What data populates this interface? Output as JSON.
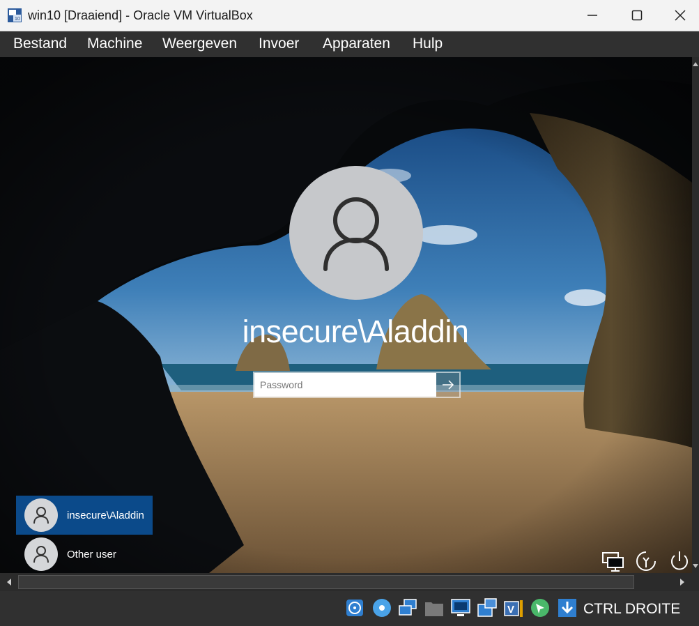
{
  "window": {
    "title": "win10 [Draaiend] - Oracle VM VirtualBox",
    "icon": "virtualbox-vm-icon",
    "controls": [
      "minimize-icon",
      "maximize-icon",
      "close-icon"
    ]
  },
  "menu": {
    "items": [
      "Bestand",
      "Machine",
      "Weergeven",
      "Invoer",
      "Apparaten",
      "Hulp"
    ]
  },
  "login": {
    "username": "insecure\\Aladdin",
    "password_placeholder": "Password",
    "submit_icon": "arrow-right-icon"
  },
  "user_tiles": [
    {
      "label": "insecure\\Aladdin",
      "selected": true
    },
    {
      "label": "Other user",
      "selected": false
    }
  ],
  "corner_icons": [
    "network-icon",
    "ease-of-access-icon",
    "power-icon"
  ],
  "status_bar": {
    "icons": [
      "hard-disk-icon",
      "optical-drive-icon",
      "network-adapters-icon",
      "shared-folders-icon",
      "display-icon",
      "video-capture-icon",
      "virtualization-icon",
      "mouse-integration-icon",
      "download-icon"
    ],
    "host_key": "CTRL DROITE"
  },
  "colors": {
    "selected_tile": "#0b4a8a",
    "menubar": "#303030",
    "titlebar": "#f3f3f3"
  }
}
